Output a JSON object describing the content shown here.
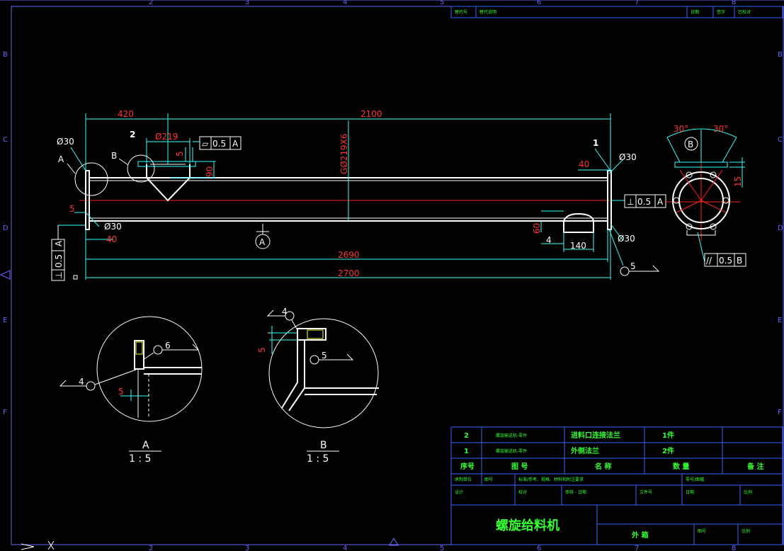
{
  "colors": {
    "background": "#000000",
    "frame": "#6666ff",
    "part": "#ffffff",
    "dimension": "#33ffff",
    "dim_text": "#ff3333",
    "centerline": "#ff2222",
    "title_text": "#33ff33",
    "title_line": "#3366ff",
    "hatch": "#ffff33"
  },
  "border": {
    "zones_x": [
      "2",
      "3",
      "4",
      "5",
      "6",
      "7",
      "8"
    ],
    "zones_y": [
      "B",
      "C",
      "D",
      "E",
      "F"
    ]
  },
  "top_block": {
    "cells": [
      "替代号",
      "替代说明",
      "日期",
      "签字",
      "已校对"
    ]
  },
  "main_view": {
    "dims": {
      "d420": "420",
      "d2100": "2100",
      "d219": "Ø219",
      "d5a": "5",
      "d90": "90",
      "d30a": "Ø30",
      "d40a": "40",
      "d5b": "5",
      "d30b": "Ø30",
      "d40b": "40",
      "pipe": "GØ219X6",
      "d60": "60",
      "d4": "4",
      "d140": "140",
      "d30c": "Ø30",
      "d2690": "2690",
      "d2700": "2700"
    },
    "labels": {
      "la": "A",
      "lb": "B",
      "l2": "2",
      "l1": "1",
      "weld5": "5",
      "sectA": "A"
    },
    "tol_flat": [
      "▱",
      "0.5",
      "A"
    ],
    "tol_perp_right": [
      "⊥",
      "0.5",
      "A"
    ],
    "tol_perp_left": [
      "⊥",
      "0.5",
      "A"
    ]
  },
  "side_view": {
    "ang_l": "30°",
    "ang_r": "30°",
    "label": "B",
    "d15": "15",
    "tol_par": [
      "//",
      "0.5",
      "B"
    ]
  },
  "detail_a": {
    "weld6": "6",
    "weld4": "4",
    "d5": "5",
    "name": "A",
    "scale": "1 : 5"
  },
  "detail_b": {
    "weld4": "4",
    "weld5": "5",
    "d5": "5",
    "name": "B",
    "scale": "1 : 5"
  },
  "bom": {
    "rows": [
      {
        "no": "2",
        "code": "螺旋输送机-零件",
        "name": "进料口连接法兰",
        "qty": "1件",
        "note": ""
      },
      {
        "no": "1",
        "code": "螺旋输送机-零件",
        "name": "外侧法兰",
        "qty": "2件",
        "note": ""
      }
    ],
    "header": {
      "no": "序号",
      "code": "图 号",
      "name": "名 称",
      "qty": "数 量",
      "note": "备 注"
    }
  },
  "title_block": {
    "r1": [
      "承制单位",
      "图号",
      "标准/参考、规格、材料和附注要求",
      "",
      "零号/图幅"
    ],
    "r2": [
      "设计",
      "校对",
      "审核 - 日期",
      "文件号",
      "日期",
      "比例"
    ],
    "title": "螺旋给料机",
    "sub": "外 箱",
    "sheet": [
      "图号",
      "比例"
    ]
  }
}
